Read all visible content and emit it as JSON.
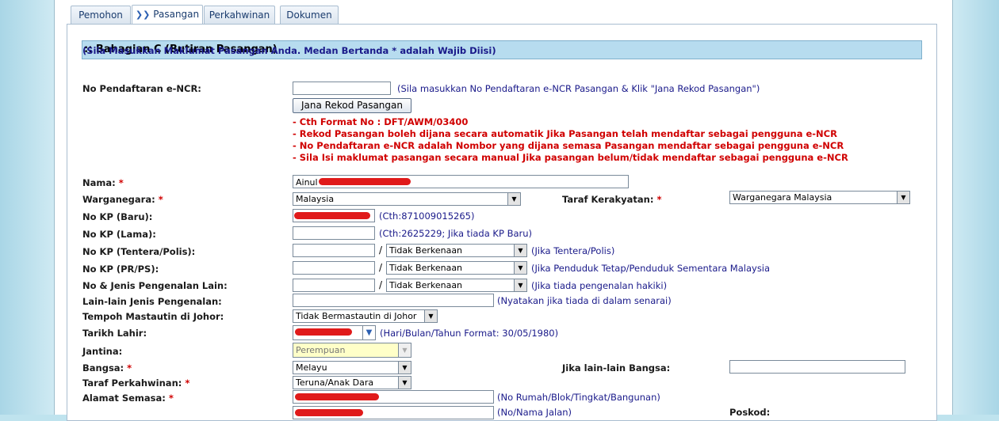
{
  "tabs": [
    {
      "label": "Pemohon",
      "active": false
    },
    {
      "label": "Pasangan",
      "active": true
    },
    {
      "label": "Perkahwinan",
      "active": false
    },
    {
      "label": "Dokumen",
      "active": false
    }
  ],
  "section_title": ":: Bahagian C (Butiran Pasangan)",
  "intro": "(Sila Masukkan Maklumat Pasangan Anda. Medan Bertanda * adalah Wajib Diisi)",
  "required_mark": "*",
  "slash": "/",
  "dropdown_icon": "▼",
  "ncr": {
    "label": "No Pendaftaran e-NCR:",
    "value": "",
    "hint": "(Sila masukkan No Pendaftaran e-NCR Pasangan & Klik \"Jana Rekod Pasangan\")",
    "button": "Jana Rekod Pasangan",
    "warnings": [
      "- Cth Format No : DFT/AWM/03400",
      "- Rekod Pasangan boleh dijana secara automatik Jika Pasangan telah mendaftar sebagai pengguna e-NCR",
      "- No Pendaftaran e-NCR adalah Nombor yang dijana semasa Pasangan mendaftar sebagai pengguna e-NCR",
      "- Sila Isi maklumat pasangan secara manual Jika pasangan belum/tidak mendaftar sebagai pengguna e-NCR"
    ]
  },
  "nama": {
    "label": "Nama:",
    "value": "Ainul"
  },
  "warganegara": {
    "label": "Warganegara:",
    "value": "Malaysia"
  },
  "taraf_kerakyatan": {
    "label": "Taraf Kerakyatan:",
    "value": "Warganegara Malaysia"
  },
  "kp_baru": {
    "label": "No KP (Baru):",
    "hint": "(Cth:871009015265)"
  },
  "kp_lama": {
    "label": "No KP (Lama):",
    "value": "",
    "hint": "(Cth:2625229; Jika tiada KP Baru)"
  },
  "kp_tentera": {
    "label": "No KP (Tentera/Polis):",
    "value": "",
    "select": "Tidak Berkenaan",
    "hint": "(Jika Tentera/Polis)"
  },
  "kp_prps": {
    "label": "No KP (PR/PS):",
    "value": "",
    "select": "Tidak Berkenaan",
    "hint": "(Jika Penduduk Tetap/Penduduk Sementara Malaysia"
  },
  "pengenalan_lain": {
    "label": "No & Jenis Pengenalan Lain:",
    "value": "",
    "select": "Tidak Berkenaan",
    "hint": "(Jika tiada pengenalan hakiki)"
  },
  "lain_jenis": {
    "label": "Lain-lain Jenis Pengenalan:",
    "value": "",
    "hint": "(Nyatakan jika tiada di dalam senarai)"
  },
  "tempoh": {
    "label": "Tempoh Mastautin di Johor:",
    "value": "Tidak Bermastautin di Johor"
  },
  "tarikh_lahir": {
    "label": "Tarikh Lahir:",
    "hint": "(Hari/Bulan/Tahun Format: 30/05/1980)"
  },
  "jantina": {
    "label": "Jantina:",
    "value": "Perempuan"
  },
  "bangsa": {
    "label": "Bangsa:",
    "value": "Melayu"
  },
  "lain_bangsa": {
    "label": "Jika lain-lain Bangsa:",
    "value": ""
  },
  "taraf_perkahwinan": {
    "label": "Taraf Perkahwinan:",
    "value": "Teruna/Anak Dara"
  },
  "alamat": {
    "label": "Alamat Semasa:",
    "hint1": "(No Rumah/Blok/Tingkat/Bangunan)",
    "hint2": "(No/Nama Jalan)"
  },
  "poskod": {
    "label": "Poskod:"
  },
  "colors": {
    "required": "#d00000",
    "hint": "#1a1a8a",
    "header_bg": "#b7dcef",
    "redaction": "#e01a1a"
  }
}
